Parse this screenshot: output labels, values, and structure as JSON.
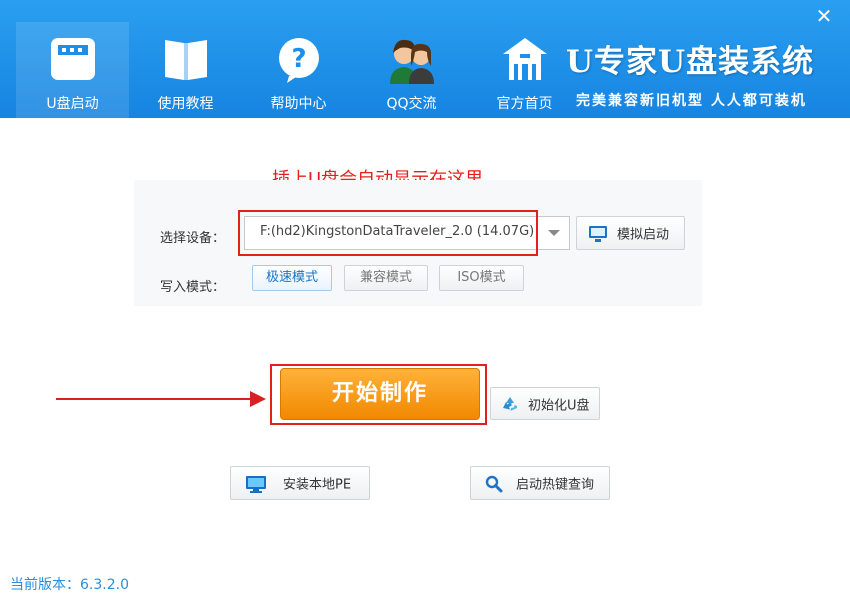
{
  "window": {
    "close_glyph": "✕"
  },
  "nav": {
    "items": [
      {
        "label": "U盘启动",
        "icon": "usb-drive-icon",
        "active": true
      },
      {
        "label": "使用教程",
        "icon": "book-icon",
        "active": false
      },
      {
        "label": "帮助中心",
        "icon": "help-icon",
        "active": false
      },
      {
        "label": "QQ交流",
        "icon": "people-icon",
        "active": false
      },
      {
        "label": "官方首页",
        "icon": "home-icon",
        "active": false
      }
    ]
  },
  "brand": {
    "title": "U专家U盘装系统",
    "slogan": "完美兼容新旧机型 人人都可装机"
  },
  "hint": "插上U盘会自动显示在这里",
  "device": {
    "label": "选择设备：",
    "value": "F:(hd2)KingstonDataTraveler_2.0 (14.07G)"
  },
  "simulate_button": "模拟启动",
  "write_mode": {
    "label": "写入模式：",
    "modes": [
      "极速模式",
      "兼容模式",
      "ISO模式"
    ],
    "selected": "极速模式"
  },
  "start_button": "开始制作",
  "format_button": "初始化U盘",
  "install_pe_button": "安装本地PE",
  "hotkey_button": "启动热键查询",
  "version": "当前版本：6.3.2.0",
  "colors": {
    "header": "#1e8fe8",
    "accent_red": "#e4201d",
    "start_orange": "#f59a10",
    "version_blue": "#2a8fd8"
  }
}
